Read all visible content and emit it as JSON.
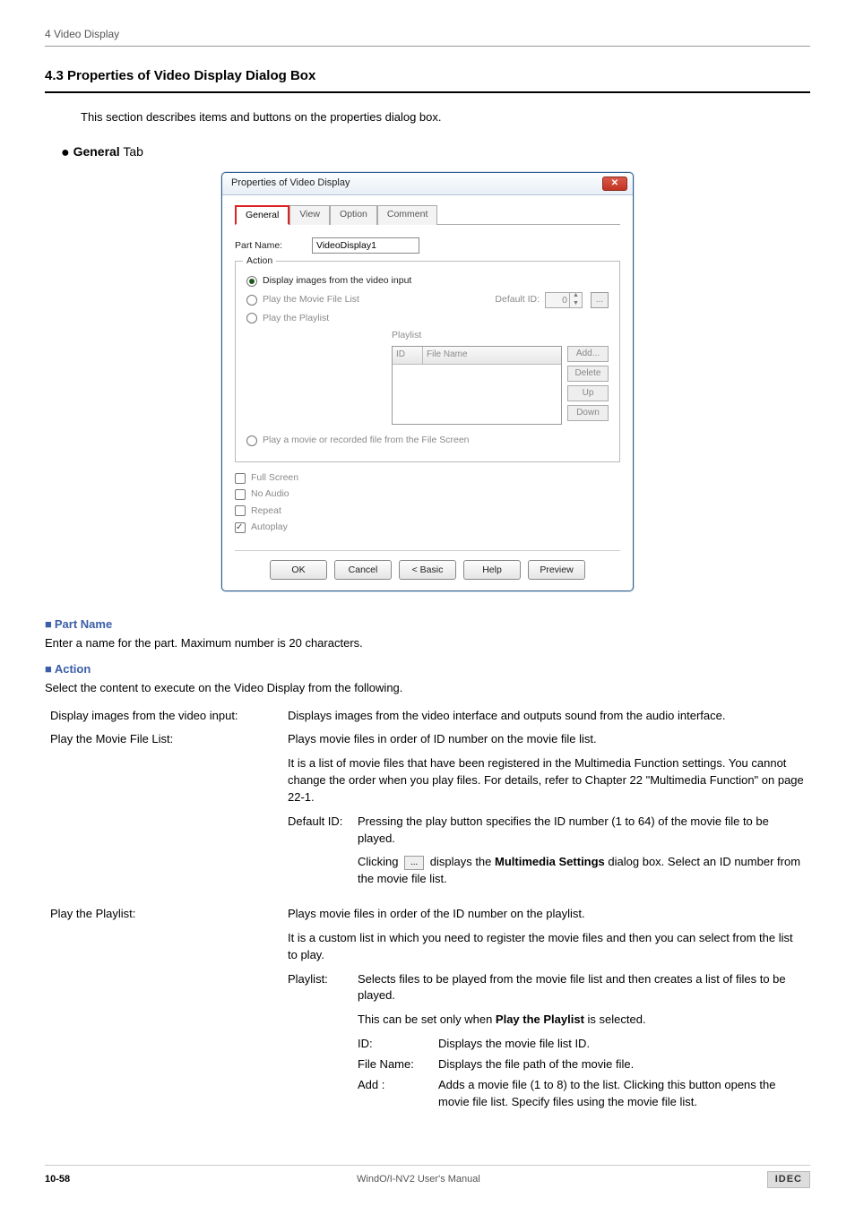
{
  "top_header": "4 Video Display",
  "section_heading": "4.3   Properties of Video Display Dialog Box",
  "intro_text": "This section describes items and buttons on the properties dialog box.",
  "tab_heading_label": "General",
  "tab_heading_suffix": " Tab",
  "dialog": {
    "title": "Properties of Video Display",
    "tabs": [
      "General",
      "View",
      "Option",
      "Comment"
    ],
    "part_name_label": "Part Name:",
    "part_name_value": "VideoDisplay1",
    "action_legend": "Action",
    "opt_video_input": "Display images from the video input",
    "opt_movie_list": "Play the Movie File List",
    "default_id_label": "Default ID:",
    "default_id_value": "0",
    "opt_playlist": "Play the Playlist",
    "playlist_label": "Playlist",
    "col_id": "ID",
    "col_filename": "File Name",
    "btn_add": "Add...",
    "btn_delete": "Delete",
    "btn_up": "Up",
    "btn_down": "Down",
    "opt_file_screen": "Play a movie or recorded file from the File Screen",
    "chk_full": "Full Screen",
    "chk_noaudio": "No Audio",
    "chk_repeat": "Repeat",
    "chk_autoplay": "Autoplay",
    "btn_ok": "OK",
    "btn_cancel": "Cancel",
    "btn_basic": "< Basic",
    "btn_help": "Help",
    "btn_preview": "Preview"
  },
  "partname_h": "Part Name",
  "partname_text": "Enter a name for the part. Maximum number is 20 characters.",
  "action_h": "Action",
  "action_text": "Select the content to execute on the Video Display from the following.",
  "rows": {
    "r1_l": "Display images from the video input:",
    "r1_r": "Displays images from the video interface and outputs sound from the audio interface.",
    "r2_l": "Play the Movie File List:",
    "r2_r1": "Plays movie files in order of ID number on the movie file list.",
    "r2_r2": "It is a list of movie files that have been registered in the Multimedia Function settings. You cannot change the order when you play files. For details, refer to Chapter 22 \"Multimedia Function\" on page 22-1.",
    "did_l": "Default ID:",
    "did_r1": "Pressing the play button specifies the ID number (1 to 64) of the movie file to be played.",
    "did_r2a": "Clicking ",
    "did_r2b": " displays the ",
    "did_r2_bold": "Multimedia Settings",
    "did_r2c": " dialog box. Select an ID number from the movie file list.",
    "r3_l": "Play the Playlist:",
    "r3_r1": "Plays movie files in order of the ID number on the playlist.",
    "r3_r2": "It is a custom list in which you need to register the movie files and then you can select from the list to play.",
    "pl_l": "Playlist:",
    "pl_r1": "Selects files to be played from the movie file list and then creates a list of files to be played.",
    "pl_r2a": "This can be set only when ",
    "pl_r2_bold": "Play the Playlist",
    "pl_r2b": " is selected.",
    "id_l": "ID:",
    "id_r": "Displays the movie file list ID.",
    "fn_l": "File Name:",
    "fn_r": "Displays the file path of the movie file.",
    "add_l": "Add :",
    "add_r": "Adds a movie file (1 to 8) to the list. Clicking this button opens the movie file list. Specify files using the movie file list."
  },
  "footer": {
    "page": "10-58",
    "manual": "WindO/I-NV2 User's Manual",
    "logo": "IDEC"
  }
}
